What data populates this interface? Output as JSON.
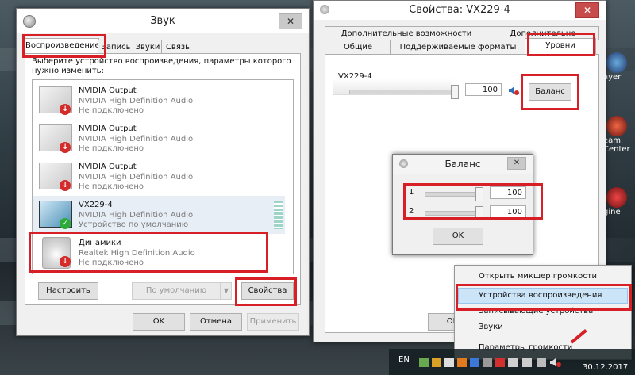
{
  "sound": {
    "title": "Звук",
    "close": "✕",
    "tabs": [
      "Воспроизведение",
      "Запись",
      "Звуки",
      "Связь"
    ],
    "prompt_line1": "Выберите устройство воспроизведения, параметры которого",
    "prompt_line2": "нужно изменить:",
    "devices": [
      {
        "name": "NVIDIA Output",
        "driver": "NVIDIA High Definition Audio",
        "status": "Не подключено"
      },
      {
        "name": "NVIDIA Output",
        "driver": "NVIDIA High Definition Audio",
        "status": "Не подключено"
      },
      {
        "name": "NVIDIA Output",
        "driver": "NVIDIA High Definition Audio",
        "status": "Не подключено"
      },
      {
        "name": "VX229-4",
        "driver": "NVIDIA High Definition Audio",
        "status": "Устройство по умолчанию"
      },
      {
        "name": "Динамики",
        "driver": "Realtek High Definition Audio",
        "status": "Не подключено"
      }
    ],
    "configure": "Настроить",
    "set_default": "По умолчанию",
    "properties": "Свойства",
    "ok": "OK",
    "cancel": "Отмена",
    "apply": "Применить"
  },
  "props": {
    "title": "Свойства: VX229-4",
    "close": "✕",
    "tabs_row1": [
      "Дополнительные возможности",
      "Дополнительно"
    ],
    "tabs_row2": [
      "Общие",
      "Поддерживаемые форматы",
      "Уровни"
    ],
    "device_label": "VX229-4",
    "level_value": "100",
    "balance_button": "Баланс",
    "ok": "OK"
  },
  "balance": {
    "title": "Баланс",
    "close": "✕",
    "ch1_label": "1",
    "ch1_value": "100",
    "ch2_label": "2",
    "ch2_value": "100",
    "ok": "OK"
  },
  "context_menu": {
    "items": [
      "Открыть микшер громкости",
      "Устройства воспроизведения",
      "Записывающие устройства",
      "Звуки",
      "Параметры громкости"
    ]
  },
  "desktop_labels": [
    "ayer",
    "eam",
    "Center",
    "gine"
  ],
  "taskbar": {
    "lang": "EN",
    "date": "30.12.2017"
  },
  "colors": {
    "highlight": "#d91f26",
    "selection": "#cce4f7"
  }
}
